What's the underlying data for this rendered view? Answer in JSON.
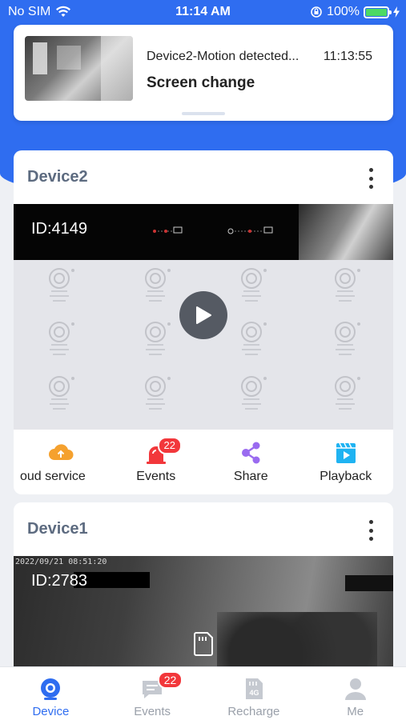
{
  "status_bar": {
    "carrier": "No SIM",
    "time": "11:14 AM",
    "battery": "100%",
    "battery_level": 1.0
  },
  "notification": {
    "title": "Device2-Motion detected...",
    "time": "11:13:55",
    "subtitle": "Screen change"
  },
  "devices": [
    {
      "name": "Device2",
      "id_label": "ID:4149",
      "actions": [
        {
          "label": "oud service",
          "icon": "cloud-icon",
          "color": "#f5a12e"
        },
        {
          "label": "Events",
          "icon": "alarm-icon",
          "color": "#f2373b",
          "badge": "22"
        },
        {
          "label": "Share",
          "icon": "share-icon",
          "color": "#9a6bf0"
        },
        {
          "label": "Playback",
          "icon": "playback-icon",
          "color": "#1fb3f2"
        }
      ]
    },
    {
      "name": "Device1",
      "id_label": "ID:2783",
      "overlay_timestamp": "2022/09/21 08:51:20"
    }
  ],
  "tabbar": {
    "items": [
      {
        "label": "Device",
        "icon": "camera-icon",
        "active": true
      },
      {
        "label": "Events",
        "icon": "message-icon",
        "badge": "22"
      },
      {
        "label": "Recharge",
        "icon": "sim-card-icon"
      },
      {
        "label": "Me",
        "icon": "user-icon"
      }
    ]
  },
  "colors": {
    "primary": "#2f6df0",
    "badge": "#f2373b",
    "card_title": "#5d6b80"
  }
}
